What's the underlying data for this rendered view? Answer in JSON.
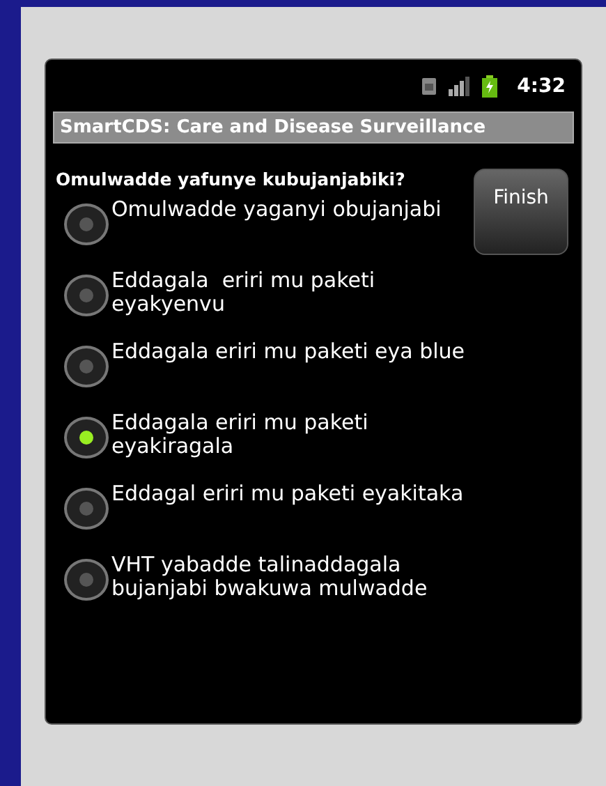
{
  "status_bar": {
    "time": "4:32"
  },
  "title_bar": {
    "title": "SmartCDS: Care and Disease Surveillance"
  },
  "question": "Omulwadde yafunye kubujanjabiki?",
  "options": [
    {
      "label": "Omulwadde yaganyi obujanjabi",
      "selected": false
    },
    {
      "label": "Eddagala  eriri mu paketi eyakyenvu",
      "selected": false
    },
    {
      "label": "Eddagala eriri mu paketi eya blue",
      "selected": false
    },
    {
      "label": "Eddagala eriri mu paketi eyakiragala",
      "selected": true
    },
    {
      "label": "Eddagal eriri mu paketi eyakitaka",
      "selected": false
    },
    {
      "label": "VHT yabadde talinaddagala bujanjabi bwakuwa mulwadde",
      "selected": false
    }
  ],
  "finish_button": "Finish"
}
